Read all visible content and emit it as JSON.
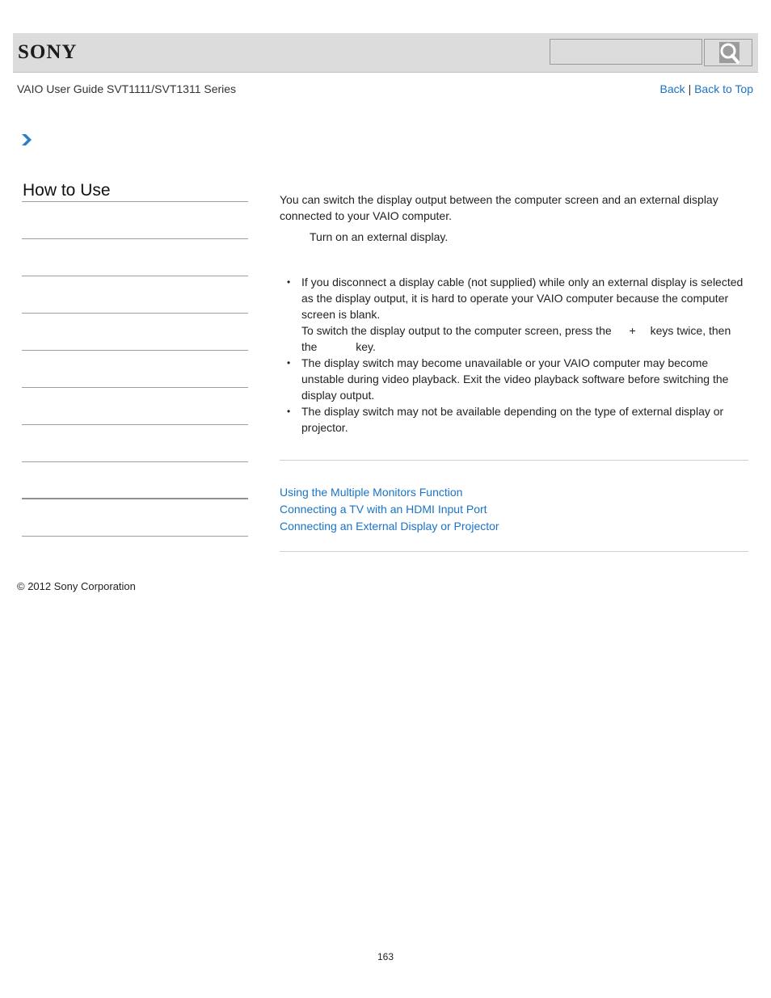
{
  "header": {
    "logo": "SONY",
    "search": {
      "value": "",
      "placeholder": "",
      "button_icon": "search-icon"
    }
  },
  "subheader": {
    "guide_title": "VAIO User Guide SVT1111/SVT1311 Series",
    "back_label": "Back",
    "separator": "|",
    "back_to_top_label": "Back to Top"
  },
  "breadcrumb": {
    "icon": "chevron-right-icon"
  },
  "sidebar": {
    "title": "How to Use",
    "items": [
      {
        "label": ""
      },
      {
        "label": ""
      },
      {
        "label": ""
      },
      {
        "label": ""
      },
      {
        "label": ""
      },
      {
        "label": ""
      },
      {
        "label": ""
      },
      {
        "label": ""
      },
      {
        "label": ""
      }
    ]
  },
  "main": {
    "intro": "You can switch the display output between the computer screen and an external display connected to your VAIO computer.",
    "step": "Turn on an external display.",
    "notes": [
      {
        "text": "If you disconnect a display cable (not supplied) while only an external display is selected as the display output, it is hard to operate your VAIO computer because the computer screen is blank.",
        "extra_before": "To switch the display output to the computer screen, press the ",
        "plus": "+",
        "extra_mid": " keys twice, then the ",
        "extra_after": " key."
      },
      {
        "text": "The display switch may become unavailable or your VAIO computer may become unstable during video playback. Exit the video playback software before switching the display output."
      },
      {
        "text": "The display switch may not be available depending on the type of external display or projector."
      }
    ],
    "bullet": "•",
    "related_links": [
      "Using the Multiple Monitors Function",
      "Connecting a TV with an HDMI Input Port",
      "Connecting an External Display or Projector"
    ]
  },
  "footer": {
    "copyright": "© 2012 Sony Corporation",
    "page_number": "163"
  },
  "colors": {
    "link": "#1a73c4",
    "header_bg": "#dcdcdc",
    "chevron": "#2a7fc6"
  }
}
